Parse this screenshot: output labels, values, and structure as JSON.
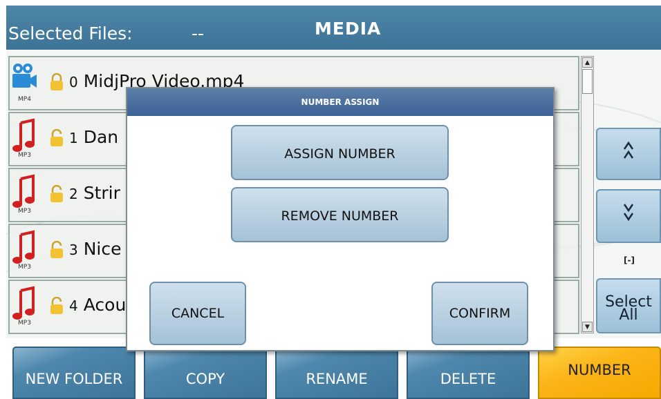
{
  "header": {
    "selected_files_label": "Selected Files:",
    "selected_files_value": "--",
    "title": "MEDIA"
  },
  "files": [
    {
      "number": "0",
      "name": "MidjPro Video.mp4",
      "type": "MP4",
      "icon": "video-camera-icon"
    },
    {
      "number": "1",
      "name": "Dan",
      "type": "MP3",
      "icon": "music-note-icon"
    },
    {
      "number": "2",
      "name": "Strir",
      "type": "MP3",
      "icon": "music-note-icon"
    },
    {
      "number": "3",
      "name": "Nice",
      "type": "MP3",
      "icon": "music-note-icon"
    },
    {
      "number": "4",
      "name": "Acou",
      "type": "MP3",
      "icon": "music-note-icon"
    }
  ],
  "side": {
    "up_label": "^^",
    "down_label": "vv",
    "bracket_label": "[-]",
    "select_all_label_1": "Select",
    "select_all_label_2": "All"
  },
  "toolbar": {
    "new_folder": "NEW FOLDER",
    "copy": "COPY",
    "rename": "RENAME",
    "delete": "DELETE",
    "number": "NUMBER"
  },
  "dialog": {
    "title": "NUMBER ASSIGN",
    "assign_label": "ASSIGN NUMBER",
    "remove_label": "REMOVE NUMBER",
    "cancel_label": "CANCEL",
    "confirm_label": "CONFIRM"
  },
  "colors": {
    "header_bg": "#4e86a8",
    "button_blue": "#3e7498",
    "button_active": "#fbb518",
    "music_note": "#d02020",
    "video_icon": "#2a8bd6",
    "lock": "#f2c230"
  }
}
